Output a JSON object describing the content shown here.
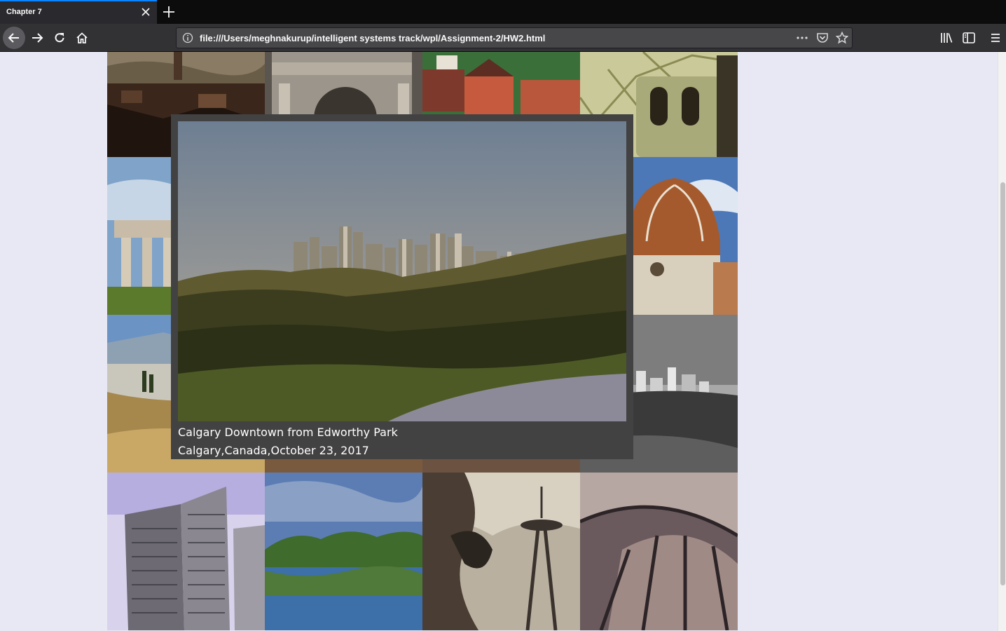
{
  "browser": {
    "tab_title": "Chapter 7",
    "url": "file:///Users/meghnakurup/intelligent systems track/wpl/Assignment-2/HW2.html",
    "accent_color": "#0a84ff",
    "icons": [
      "back-arrow-icon",
      "forward-arrow-icon",
      "reload-icon",
      "home-icon",
      "info-icon",
      "more-dots-icon",
      "pocket-icon",
      "bookmark-star-icon",
      "library-icon",
      "sidebar-icon",
      "hamburger-menu-icon",
      "close-icon",
      "plus-icon"
    ]
  },
  "gallery": {
    "tiles": [
      "cityscape-aerial",
      "triumphal-arch",
      "harbor-buildings",
      "british-museum",
      "greek-temple",
      "skyline-popup-hidden-1",
      "skyline-popup-hidden-2",
      "florence-duomo",
      "hillside-ruins",
      "hidden-3",
      "hidden-4",
      "calgary-skyline-bw",
      "office-towers",
      "park-lake",
      "space-needle",
      "curved-roof"
    ]
  },
  "popup": {
    "title": "Calgary Downtown from Edworthy Park",
    "subtitle": "Calgary,Canada,October 23, 2017"
  }
}
